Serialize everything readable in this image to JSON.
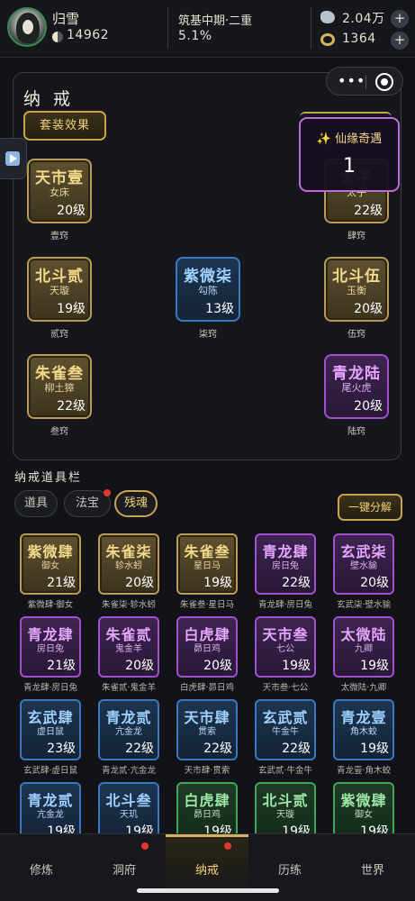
{
  "player": {
    "name": "归雪",
    "power": "14962"
  },
  "realm": {
    "title": "筑基中期·二重",
    "progress": "5.1%"
  },
  "resources": {
    "spirit_stones": "2.04万",
    "jade": "1364"
  },
  "panel": {
    "title": "纳 戒",
    "set_effect_label": "套装效果"
  },
  "popup": {
    "title": "✨ 仙缘奇遇",
    "count": "1"
  },
  "ring_slots": [
    {
      "name": "天市壹",
      "sub": "女床",
      "level": "20级",
      "caption": "壹窍",
      "rarity": "gold"
    },
    {
      "name": "太子",
      "sub": "太子",
      "level": "22级",
      "caption": "肆窍",
      "rarity": "gold"
    },
    {
      "name": "北斗贰",
      "sub": "天璇",
      "level": "19级",
      "caption": "贰窍",
      "rarity": "gold"
    },
    {
      "name": "紫微柒",
      "sub": "勾陈",
      "level": "13级",
      "caption": "柒窍",
      "rarity": "blue"
    },
    {
      "name": "北斗伍",
      "sub": "玉衡",
      "level": "20级",
      "caption": "伍窍",
      "rarity": "gold"
    },
    {
      "name": "朱雀叁",
      "sub": "柳土獐",
      "level": "22级",
      "caption": "叁窍",
      "rarity": "gold"
    },
    {
      "name": "青龙陆",
      "sub": "尾火虎",
      "level": "20级",
      "caption": "陆窍",
      "rarity": "purple"
    }
  ],
  "toolbar": {
    "title": "纳戒道具栏",
    "tabs": [
      "道具",
      "法宝",
      "残魂"
    ],
    "active_tab": "残魂",
    "decompose_label": "一键分解"
  },
  "items": [
    {
      "name": "紫微肆",
      "sub": "御女",
      "level": "21级",
      "caption": "紫微肆·御女",
      "rarity": "gold"
    },
    {
      "name": "朱雀柒",
      "sub": "轸水蚓",
      "level": "20级",
      "caption": "朱雀柒·轸水蚓",
      "rarity": "gold"
    },
    {
      "name": "朱雀叁",
      "sub": "星日马",
      "level": "19级",
      "caption": "朱雀叁·星日马",
      "rarity": "gold"
    },
    {
      "name": "青龙肆",
      "sub": "房日兔",
      "level": "22级",
      "caption": "青龙肆·房日兔",
      "rarity": "purple"
    },
    {
      "name": "玄武柒",
      "sub": "壁水貐",
      "level": "20级",
      "caption": "玄武柒·壁水貐",
      "rarity": "purple"
    },
    {
      "name": "青龙肆",
      "sub": "房日兔",
      "level": "21级",
      "caption": "青龙肆·房日兔",
      "rarity": "purple"
    },
    {
      "name": "朱雀贰",
      "sub": "鬼金羊",
      "level": "20级",
      "caption": "朱雀贰·鬼金羊",
      "rarity": "purple"
    },
    {
      "name": "白虎肆",
      "sub": "昴日鸡",
      "level": "20级",
      "caption": "白虎肆·昴日鸡",
      "rarity": "purple"
    },
    {
      "name": "天市叁",
      "sub": "七公",
      "level": "19级",
      "caption": "天市叁·七公",
      "rarity": "purple"
    },
    {
      "name": "太微陆",
      "sub": "九卿",
      "level": "19级",
      "caption": "太微陆·九卿",
      "rarity": "purple"
    },
    {
      "name": "玄武肆",
      "sub": "虚日鼠",
      "level": "23级",
      "caption": "玄武肆·虚日鼠",
      "rarity": "blue"
    },
    {
      "name": "青龙贰",
      "sub": "亢金龙",
      "level": "22级",
      "caption": "青龙贰·亢金龙",
      "rarity": "blue"
    },
    {
      "name": "天市肆",
      "sub": "贯索",
      "level": "22级",
      "caption": "天市肆·贯索",
      "rarity": "blue"
    },
    {
      "name": "玄武贰",
      "sub": "牛金牛",
      "level": "22级",
      "caption": "玄武贰·牛金牛",
      "rarity": "blue"
    },
    {
      "name": "青龙壹",
      "sub": "角木蛟",
      "level": "19级",
      "caption": "青龙壹·角木蛟",
      "rarity": "blue"
    },
    {
      "name": "青龙贰",
      "sub": "亢金龙",
      "level": "19级",
      "caption": "",
      "rarity": "blue"
    },
    {
      "name": "北斗叁",
      "sub": "天玑",
      "level": "19级",
      "caption": "",
      "rarity": "blue"
    },
    {
      "name": "白虎肆",
      "sub": "昴日鸡",
      "level": "19级",
      "caption": "",
      "rarity": "green"
    },
    {
      "name": "北斗贰",
      "sub": "天璇",
      "level": "19级",
      "caption": "",
      "rarity": "green"
    },
    {
      "name": "紫微肆",
      "sub": "御女",
      "level": "19级",
      "caption": "",
      "rarity": "green"
    }
  ],
  "nav": [
    "修炼",
    "洞府",
    "纳戒",
    "历练",
    "世界"
  ],
  "nav_active": "纳戒"
}
